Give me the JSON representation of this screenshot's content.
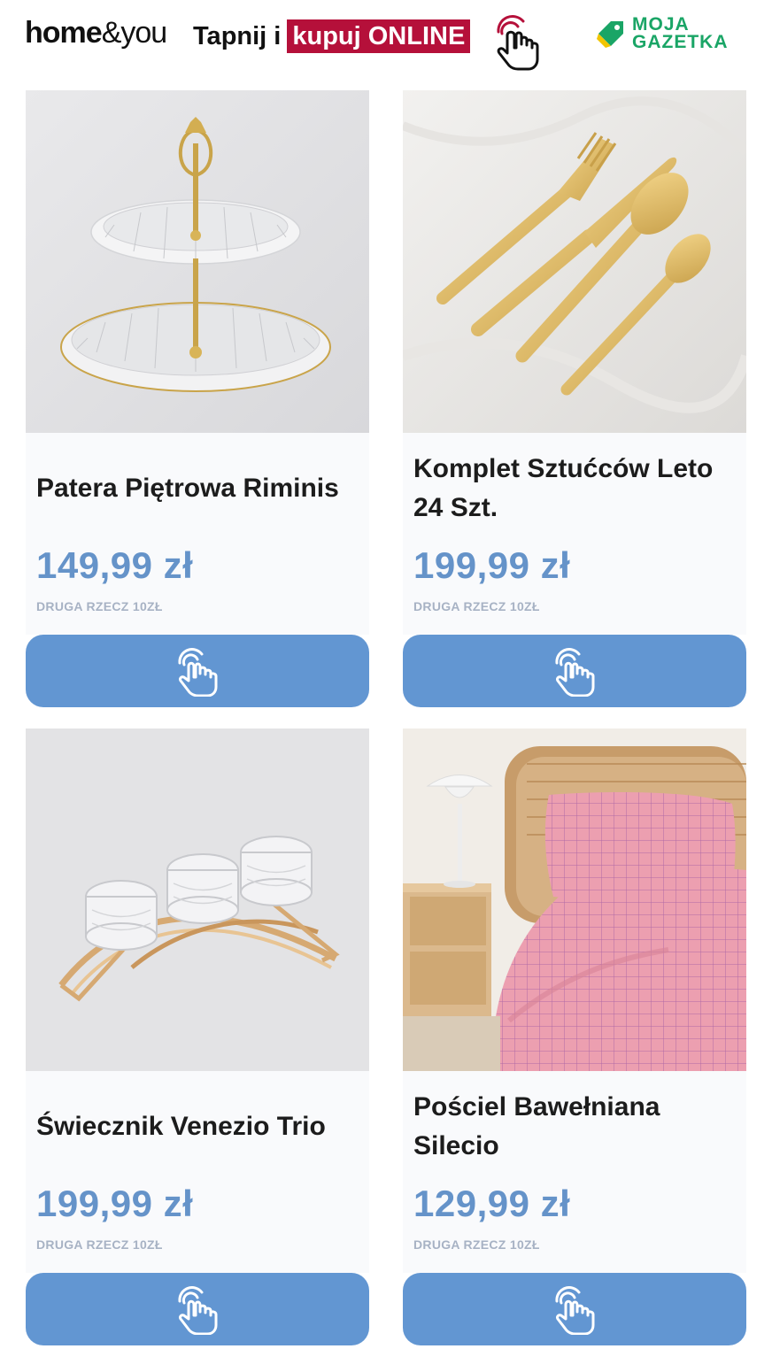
{
  "header": {
    "brand_home": "home",
    "brand_amp": "&",
    "brand_you": "you",
    "tagline_prefix": "Tapnij i",
    "tagline_highlight": "kupuj ONLINE",
    "moja_line1": "MOJA",
    "moja_line2": "GAZETKA",
    "accent_color": "#b5103a",
    "moja_color": "#1aa566"
  },
  "products": [
    {
      "title": "Patera Piętrowa Riminis",
      "price": "149,99 zł",
      "promo": "DRUGA RZECZ 10ZŁ",
      "cta_icon": "tap-hand-icon"
    },
    {
      "title": "Komplet Sztućców Leto 24 Szt.",
      "price": "199,99 zł",
      "promo": "DRUGA RZECZ 10ZŁ",
      "cta_icon": "tap-hand-icon"
    },
    {
      "title": "Świecznik Venezio Trio",
      "price": "199,99 zł",
      "promo": "DRUGA RZECZ 10ZŁ",
      "cta_icon": "tap-hand-icon"
    },
    {
      "title": "Pościel Bawełniana Silecio",
      "price": "129,99 zł",
      "promo": "DRUGA RZECZ 10ZŁ",
      "cta_icon": "tap-hand-icon"
    }
  ],
  "colors": {
    "price": "#6593c9",
    "button": "#6296d2",
    "promo": "#a7b2c4"
  }
}
